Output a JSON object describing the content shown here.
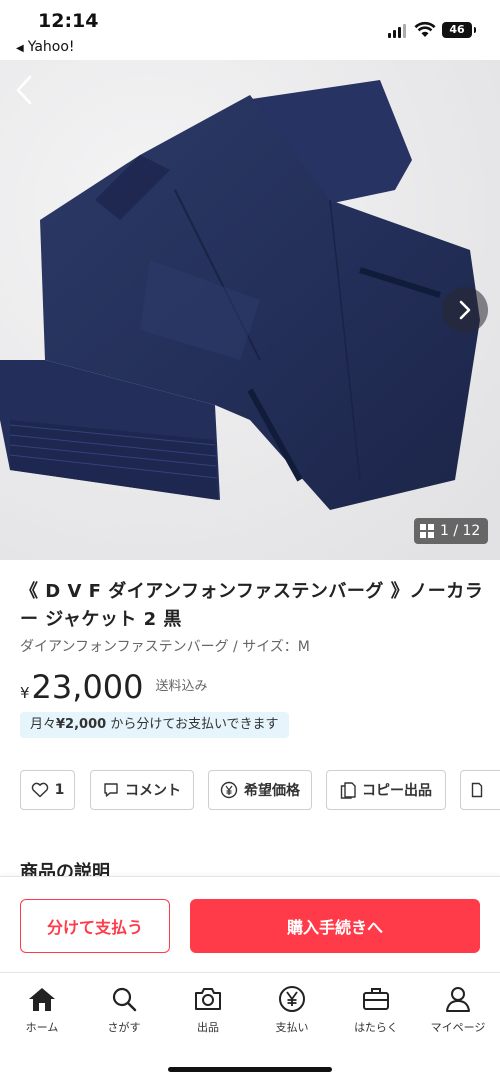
{
  "status_bar": {
    "time": "12:14",
    "back_app": "Yahoo!",
    "battery": "46"
  },
  "product": {
    "image_counter": "1 / 12",
    "title": "《 D V F ダイアンフォンファステンバーグ 》ノーカラー ジャケット 2 黒",
    "brand_size": "ダイアンフォンファステンバーグ / サイズ：M",
    "price_currency": "¥",
    "price": "23,000",
    "shipping": "送料込み",
    "installment_prefix": "月々",
    "installment_amount": "¥2,000",
    "installment_suffix": "から分けてお支払いできます"
  },
  "actions": {
    "like_count": "1",
    "comment_label": "コメント",
    "offer_label": "希望価格",
    "copy_label": "コピー出品"
  },
  "section_peek": "商品の説明",
  "buy_bar": {
    "split_label": "分けて支払う",
    "purchase_label": "購入手続きへ"
  },
  "tab_bar": {
    "items": [
      {
        "label": "ホーム",
        "icon": "home-icon"
      },
      {
        "label": "さがす",
        "icon": "search-icon"
      },
      {
        "label": "出品",
        "icon": "camera-icon"
      },
      {
        "label": "支払い",
        "icon": "yen-circle-icon"
      },
      {
        "label": "はたらく",
        "icon": "briefcase-icon"
      },
      {
        "label": "マイページ",
        "icon": "person-icon"
      }
    ]
  },
  "colors": {
    "accent": "#ff3b4a",
    "installment_bg": "#e6f4fb"
  }
}
